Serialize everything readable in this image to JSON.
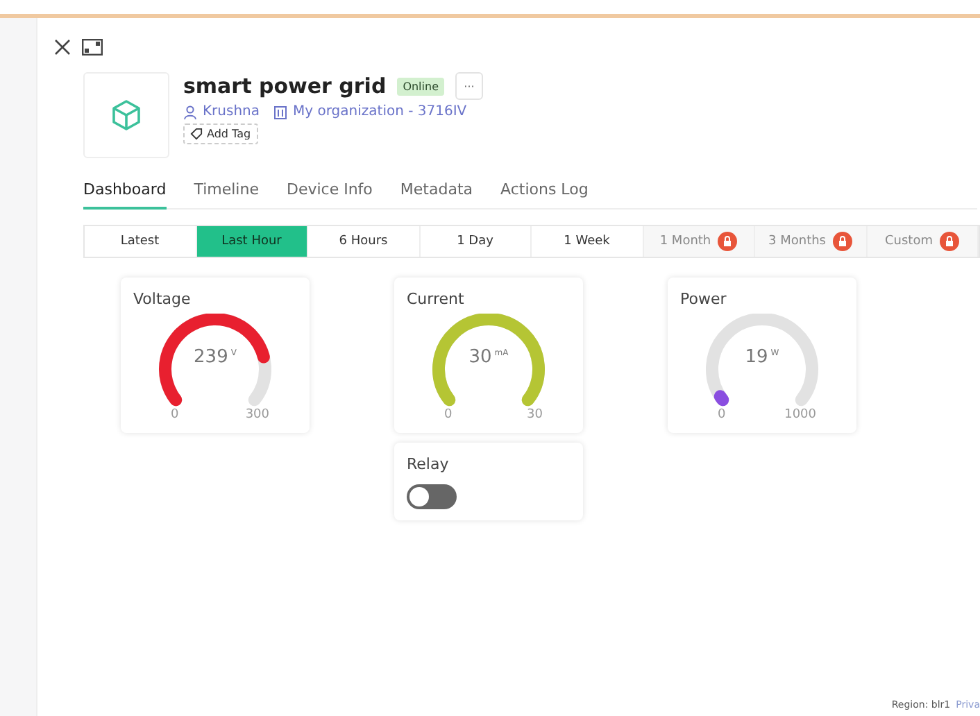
{
  "device": {
    "name": "smart power grid",
    "status": "Online",
    "owner": "Krushna",
    "organization": "My organization - 3716IV",
    "add_tag": "Add Tag",
    "more": "···"
  },
  "tabs": [
    {
      "label": "Dashboard",
      "selected": true
    },
    {
      "label": "Timeline",
      "selected": false
    },
    {
      "label": "Device Info",
      "selected": false
    },
    {
      "label": "Metadata",
      "selected": false
    },
    {
      "label": "Actions Log",
      "selected": false
    }
  ],
  "ranges": [
    {
      "label": "Latest",
      "selected": false,
      "locked": false
    },
    {
      "label": "Last Hour",
      "selected": true,
      "locked": false
    },
    {
      "label": "6 Hours",
      "selected": false,
      "locked": false
    },
    {
      "label": "1 Day",
      "selected": false,
      "locked": false
    },
    {
      "label": "1 Week",
      "selected": false,
      "locked": false
    },
    {
      "label": "1 Month",
      "selected": false,
      "locked": true
    },
    {
      "label": "3 Months",
      "selected": false,
      "locked": true
    },
    {
      "label": "Custom",
      "selected": false,
      "locked": true
    }
  ],
  "gauges": [
    {
      "title": "Voltage",
      "value": "239",
      "unit": "V",
      "min": "0",
      "max": "300",
      "color": "#e8202f"
    },
    {
      "title": "Current",
      "value": "30",
      "unit": "mA",
      "min": "0",
      "max": "30",
      "color": "#b5c534"
    },
    {
      "title": "Power",
      "value": "19",
      "unit": "W",
      "min": "0",
      "max": "1000",
      "color": "#8a4ee0"
    }
  ],
  "relay": {
    "title": "Relay",
    "on": false
  },
  "footer": {
    "region": "Region: blr1",
    "link": "Priva"
  }
}
